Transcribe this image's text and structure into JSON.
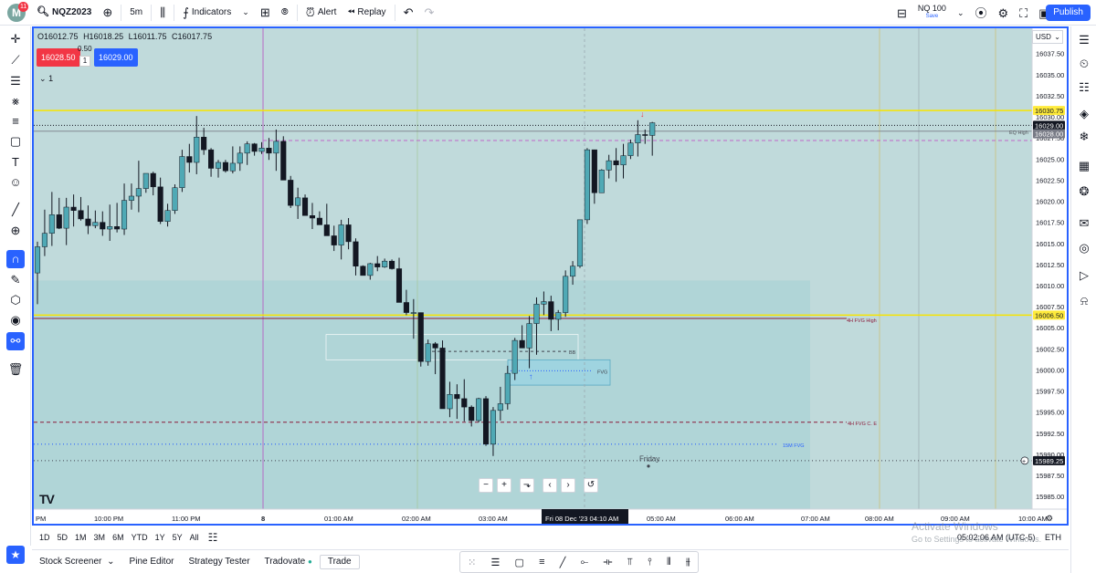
{
  "header": {
    "avatar_letter": "M",
    "notification_count": "11",
    "symbol": "NQZ2023",
    "interval": "5m",
    "indicators_label": "Indicators",
    "alert_label": "Alert",
    "replay_label": "Replay",
    "layout_name": "NQ 100",
    "layout_status": "Save",
    "publish_label": "Publish"
  },
  "legend": {
    "open": "O16012.75",
    "high": "H16018.25",
    "low": "L16011.75",
    "close": "C16017.75",
    "sell_price": "16028.50",
    "buy_price": "16029.00",
    "spread": "0.50",
    "quantity": "1",
    "collapse_count": "1"
  },
  "currency": "USD",
  "chart_data": {
    "type": "candlestick",
    "symbol": "NQZ2023",
    "interval": "5m",
    "x_ticks": [
      "PM",
      "10:00 PM",
      "11:00 PM",
      "8",
      "01:00 AM",
      "02:00 AM",
      "03:00 AM",
      "05:00 AM",
      "06:00 AM",
      "07:00 AM",
      "08:00 AM",
      "09:00 AM",
      "10:00 AM"
    ],
    "crosshair_label": "Fri 08 Dec '23   04:10 AM",
    "y_ticks": [
      15985.0,
      15987.5,
      15990.0,
      15992.5,
      15995.0,
      15997.5,
      16000.0,
      16002.5,
      16005.0,
      16007.5,
      16010.0,
      16012.5,
      16015.0,
      16017.5,
      16020.0,
      16022.5,
      16025.0,
      16027.5,
      16030.0,
      16032.5,
      16035.0,
      16037.5
    ],
    "y_range": [
      15983.5,
      16040.5
    ],
    "price_labels": [
      {
        "value": "16030.75",
        "color": "#ffeb3b",
        "text_color": "#131722"
      },
      {
        "value": "16029.00",
        "color": "#131722",
        "text_color": "#ffffff"
      },
      {
        "value": "16028.00",
        "color": "#787b86",
        "text_color": "#ffffff"
      },
      {
        "value": "16006.50",
        "color": "#ffeb3b",
        "text_color": "#131722"
      },
      {
        "value": "15989.25",
        "color": "#131722",
        "text_color": "#ffffff"
      }
    ],
    "annotations": [
      {
        "text": "EQ High",
        "price": 16028.3
      },
      {
        "text": "4H FVG High",
        "price": 16006.0
      },
      {
        "text": "BB",
        "price": 16002.2
      },
      {
        "text": "FVG",
        "price": 15999.9
      },
      {
        "text": "4H FVG C. E",
        "price": 15993.8
      },
      {
        "text": "15M FVG",
        "price": 15991.2
      },
      {
        "text": "Friday",
        "price": 15989.5
      }
    ],
    "candles": [
      [
        16011.5,
        16015.2,
        16007.8,
        16014.6
      ],
      [
        16014.6,
        16019.0,
        16013.5,
        16016.2
      ],
      [
        16016.2,
        16021.1,
        16014.7,
        16018.4
      ],
      [
        16018.4,
        16020.4,
        16016.7,
        16016.8
      ],
      [
        16016.8,
        16020.4,
        16014.8,
        16019.3
      ],
      [
        16019.3,
        16020.8,
        16017.0,
        16018.9
      ],
      [
        16018.9,
        16020.5,
        16017.7,
        16017.9
      ],
      [
        16017.9,
        16019.5,
        16016.1,
        16017.1
      ],
      [
        16017.1,
        16018.9,
        16016.8,
        16017.5
      ],
      [
        16017.5,
        16018.8,
        16015.9,
        16016.7
      ],
      [
        16016.7,
        16019.6,
        16015.3,
        16017.0
      ],
      [
        16017.0,
        16019.8,
        16016.3,
        16016.7
      ],
      [
        16016.7,
        16022.1,
        16016.0,
        16020.1
      ],
      [
        16020.1,
        16022.1,
        16019.0,
        16020.6
      ],
      [
        16020.6,
        16024.8,
        16018.7,
        16021.5
      ],
      [
        16021.5,
        16023.3,
        16021.0,
        16023.3
      ],
      [
        16023.3,
        16023.5,
        16020.7,
        16021.7
      ],
      [
        16021.7,
        16022.8,
        16017.3,
        16017.6
      ],
      [
        16017.6,
        16019.7,
        16017.0,
        16018.9
      ],
      [
        16018.9,
        16022.0,
        16018.5,
        16021.6
      ],
      [
        16021.6,
        16026.1,
        16021.1,
        16025.3
      ],
      [
        16025.3,
        16026.8,
        16023.4,
        16024.6
      ],
      [
        16024.6,
        16030.1,
        16023.2,
        16027.6
      ],
      [
        16027.6,
        16028.7,
        16025.5,
        16026.1
      ],
      [
        16026.1,
        16026.3,
        16022.9,
        16023.9
      ],
      [
        16023.9,
        16024.9,
        16022.8,
        16024.6
      ],
      [
        16024.6,
        16024.9,
        16023.4,
        16023.6
      ],
      [
        16023.6,
        16026.5,
        16023.3,
        16024.5
      ],
      [
        16024.5,
        16026.5,
        16023.6,
        16025.7
      ],
      [
        16025.7,
        16027.1,
        16024.3,
        16026.8
      ],
      [
        16026.8,
        16026.9,
        16025.4,
        16025.9
      ],
      [
        16025.9,
        16027.0,
        16025.6,
        16026.3
      ],
      [
        16026.3,
        16027.5,
        16024.9,
        16025.7
      ],
      [
        16025.7,
        16028.5,
        16023.6,
        16027.1
      ],
      [
        16027.1,
        16027.7,
        16023.4,
        16022.5
      ],
      [
        16022.5,
        16023.0,
        16019.2,
        16019.5
      ],
      [
        16019.5,
        16021.6,
        16017.9,
        16020.4
      ],
      [
        16020.4,
        16020.8,
        16018.4,
        16018.3
      ],
      [
        16018.3,
        16019.8,
        16016.7,
        16018.0
      ],
      [
        16018.0,
        16018.8,
        16017.6,
        16017.2
      ],
      [
        16017.2,
        16019.7,
        16016.1,
        16015.9
      ],
      [
        16015.9,
        16017.1,
        16014.1,
        16014.8
      ],
      [
        16014.8,
        16017.8,
        16013.1,
        16017.2
      ],
      [
        16017.2,
        16018.0,
        16014.3,
        16015.2
      ],
      [
        16015.2,
        16015.6,
        16011.2,
        16012.3
      ],
      [
        16012.3,
        16012.4,
        16011.7,
        16011.2
      ],
      [
        16011.2,
        16012.7,
        16010.7,
        16012.6
      ],
      [
        16012.6,
        16013.5,
        16011.7,
        16012.2
      ],
      [
        16012.2,
        16013.2,
        16012.1,
        16012.9
      ],
      [
        16012.9,
        16013.1,
        16011.9,
        16012.0
      ],
      [
        16012.0,
        16013.3,
        16009.1,
        16008.0
      ],
      [
        16008.0,
        16009.5,
        16006.5,
        16006.8
      ],
      [
        16006.8,
        16008.4,
        16003.7,
        16006.8
      ],
      [
        16006.8,
        16006.8,
        16000.4,
        16001.0
      ],
      [
        16001.0,
        16003.6,
        16000.5,
        16003.1
      ],
      [
        16003.1,
        16003.3,
        15999.5,
        16002.6
      ],
      [
        16002.6,
        16003.5,
        15995.6,
        15995.4
      ],
      [
        15995.4,
        15998.6,
        15994.4,
        15997.1
      ],
      [
        15997.1,
        15998.3,
        15994.2,
        15996.6
      ],
      [
        15996.6,
        15998.9,
        15993.9,
        15995.6
      ],
      [
        15995.6,
        15995.8,
        15993.3,
        15994.0
      ],
      [
        15994.0,
        15996.7,
        15993.8,
        15996.6
      ],
      [
        15996.6,
        15996.9,
        15991.0,
        15991.2
      ],
      [
        15991.2,
        15995.6,
        15989.8,
        15995.2
      ],
      [
        15995.2,
        15998.0,
        15994.0,
        15996.0
      ],
      [
        15996.0,
        16000.5,
        15995.3,
        15999.6
      ],
      [
        15999.6,
        16003.8,
        15998.8,
        16003.5
      ],
      [
        16003.5,
        16005.3,
        16003.5,
        16002.6
      ],
      [
        16002.6,
        16006.4,
        16000.2,
        16005.5
      ],
      [
        16005.5,
        16008.6,
        16001.8,
        16007.8
      ],
      [
        16007.8,
        16009.3,
        16006.5,
        16008.1
      ],
      [
        16008.1,
        16008.8,
        16004.6,
        16006.0
      ],
      [
        16006.0,
        16007.1,
        16004.7,
        16006.8
      ],
      [
        16006.8,
        16011.8,
        16006.3,
        16011.1
      ],
      [
        16011.1,
        16012.9,
        16010.1,
        16012.3
      ],
      [
        16012.3,
        16017.7,
        16012.1,
        16017.8
      ],
      [
        16017.8,
        16026.3,
        16017.3,
        16026.1
      ],
      [
        16026.1,
        16026.1,
        16019.7,
        16021.0
      ],
      [
        16021.0,
        16023.8,
        16021.0,
        16023.7
      ],
      [
        16023.7,
        16025.5,
        16022.7,
        16024.8
      ],
      [
        16024.8,
        16026.3,
        16022.3,
        16024.3
      ],
      [
        16024.3,
        16026.8,
        16022.7,
        16025.4
      ],
      [
        16025.4,
        16027.3,
        16025.0,
        16026.9
      ],
      [
        16026.9,
        16029.6,
        16025.3,
        16027.9
      ],
      [
        16027.9,
        16028.5,
        16026.8,
        16027.8
      ],
      [
        16027.8,
        16029.4,
        16025.4,
        16029.3
      ]
    ]
  },
  "time_ranges": [
    "1D",
    "5D",
    "1M",
    "3M",
    "6M",
    "YTD",
    "1Y",
    "5Y",
    "All"
  ],
  "clock": "05:02:06 AM (UTC-5)",
  "session": "ETH",
  "watermark_title": "Activate Windows",
  "watermark_sub": "Go to Settings to activate Windows.",
  "panels": [
    "Stock Screener",
    "Pine Editor",
    "Strategy Tester",
    "Tradovate",
    "Trade"
  ]
}
